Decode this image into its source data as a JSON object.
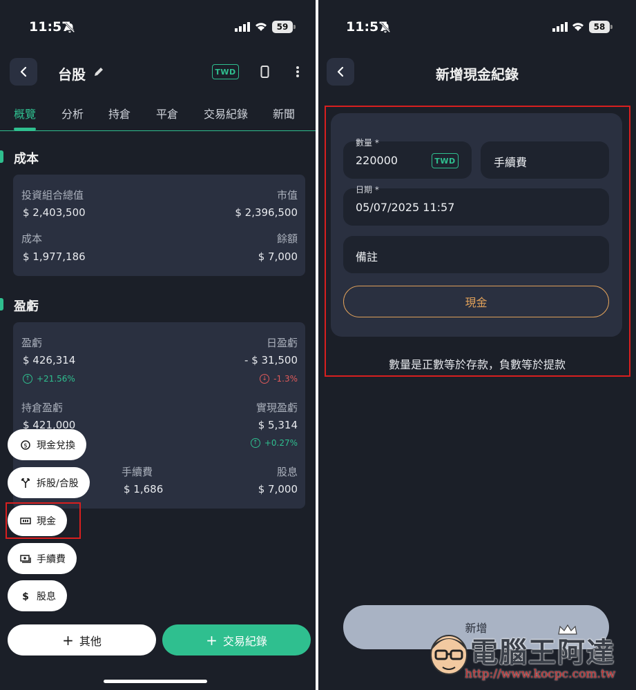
{
  "left": {
    "status": {
      "time": "11:57",
      "battery": "59"
    },
    "header": {
      "title": "台股",
      "currency": "TWD"
    },
    "tabs": [
      "概覽",
      "分析",
      "持倉",
      "平倉",
      "交易紀錄",
      "新聞"
    ],
    "cost_section": {
      "title": "成本",
      "portfolio_total_label": "投資組合總值",
      "portfolio_total_value": "$ 2,403,500",
      "market_value_label": "市值",
      "market_value_value": "$ 2,396,500",
      "cost_label": "成本",
      "cost_value": "$ 1,977,186",
      "balance_label": "餘額",
      "balance_value": "$ 7,000"
    },
    "pnl_section": {
      "title": "盈虧",
      "pnl_label": "盈虧",
      "pnl_value": "$ 426,314",
      "pnl_pct": "+21.56%",
      "daily_label": "日盈虧",
      "daily_value": "- $ 31,500",
      "daily_pct": "-1.3%",
      "holding_label": "持倉盈虧",
      "holding_value": "$ 421,000",
      "realized_label": "實現盈虧",
      "realized_value": "$ 5,314",
      "realized_pct": "+0.27%",
      "fee_label": "手續費",
      "fee_value": "$ 1,686",
      "dividend_label": "股息",
      "dividend_value": "$ 7,000"
    },
    "fab_menu": [
      "現金兌換",
      "拆股/合股",
      "現金",
      "手續費",
      "股息"
    ],
    "buttons": {
      "other": "其他",
      "trade_record": "交易紀錄"
    }
  },
  "right": {
    "status": {
      "time": "11:57",
      "battery": "58"
    },
    "header": {
      "title": "新增現金紀錄"
    },
    "form": {
      "quantity_label": "數量 *",
      "quantity_value": "220000",
      "currency": "TWD",
      "fee_placeholder": "手續費",
      "date_label": "日期 *",
      "date_value": "05/07/2025 11:57",
      "note_placeholder": "備註",
      "type_button": "現金"
    },
    "hint": "數量是正數等於存款，負數等於提款",
    "submit": "新增"
  },
  "watermark": {
    "title": "電腦王阿達",
    "url": "http://www.kocpc.com.tw"
  },
  "colors": {
    "accent": "#2fbf8f",
    "negative": "#e05a5a",
    "cash": "#e0a15a",
    "highlight": "#d91f1f"
  }
}
